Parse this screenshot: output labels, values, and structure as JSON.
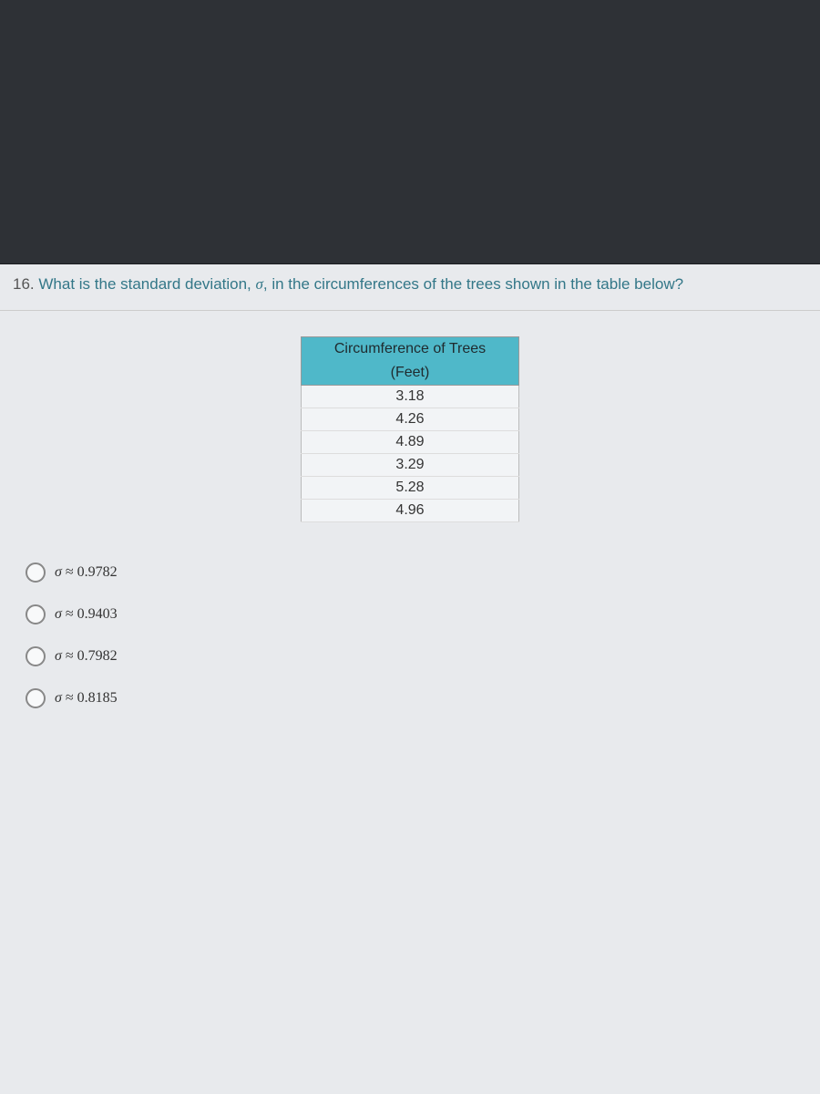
{
  "question": {
    "number": "16.",
    "text_before": "What is the standard deviation, ",
    "sigma": "σ",
    "text_after": ", in the circumferences of the trees shown in the table below?"
  },
  "table": {
    "title": "Circumference of Trees",
    "subtitle": "(Feet)",
    "values": [
      "3.18",
      "4.26",
      "4.89",
      "3.29",
      "5.28",
      "4.96"
    ]
  },
  "options": [
    {
      "sigma": "σ",
      "approx": "≈",
      "value": "0.9782"
    },
    {
      "sigma": "σ",
      "approx": "≈",
      "value": "0.9403"
    },
    {
      "sigma": "σ",
      "approx": "≈",
      "value": "0.7982"
    },
    {
      "sigma": "σ",
      "approx": "≈",
      "value": "0.8185"
    }
  ]
}
